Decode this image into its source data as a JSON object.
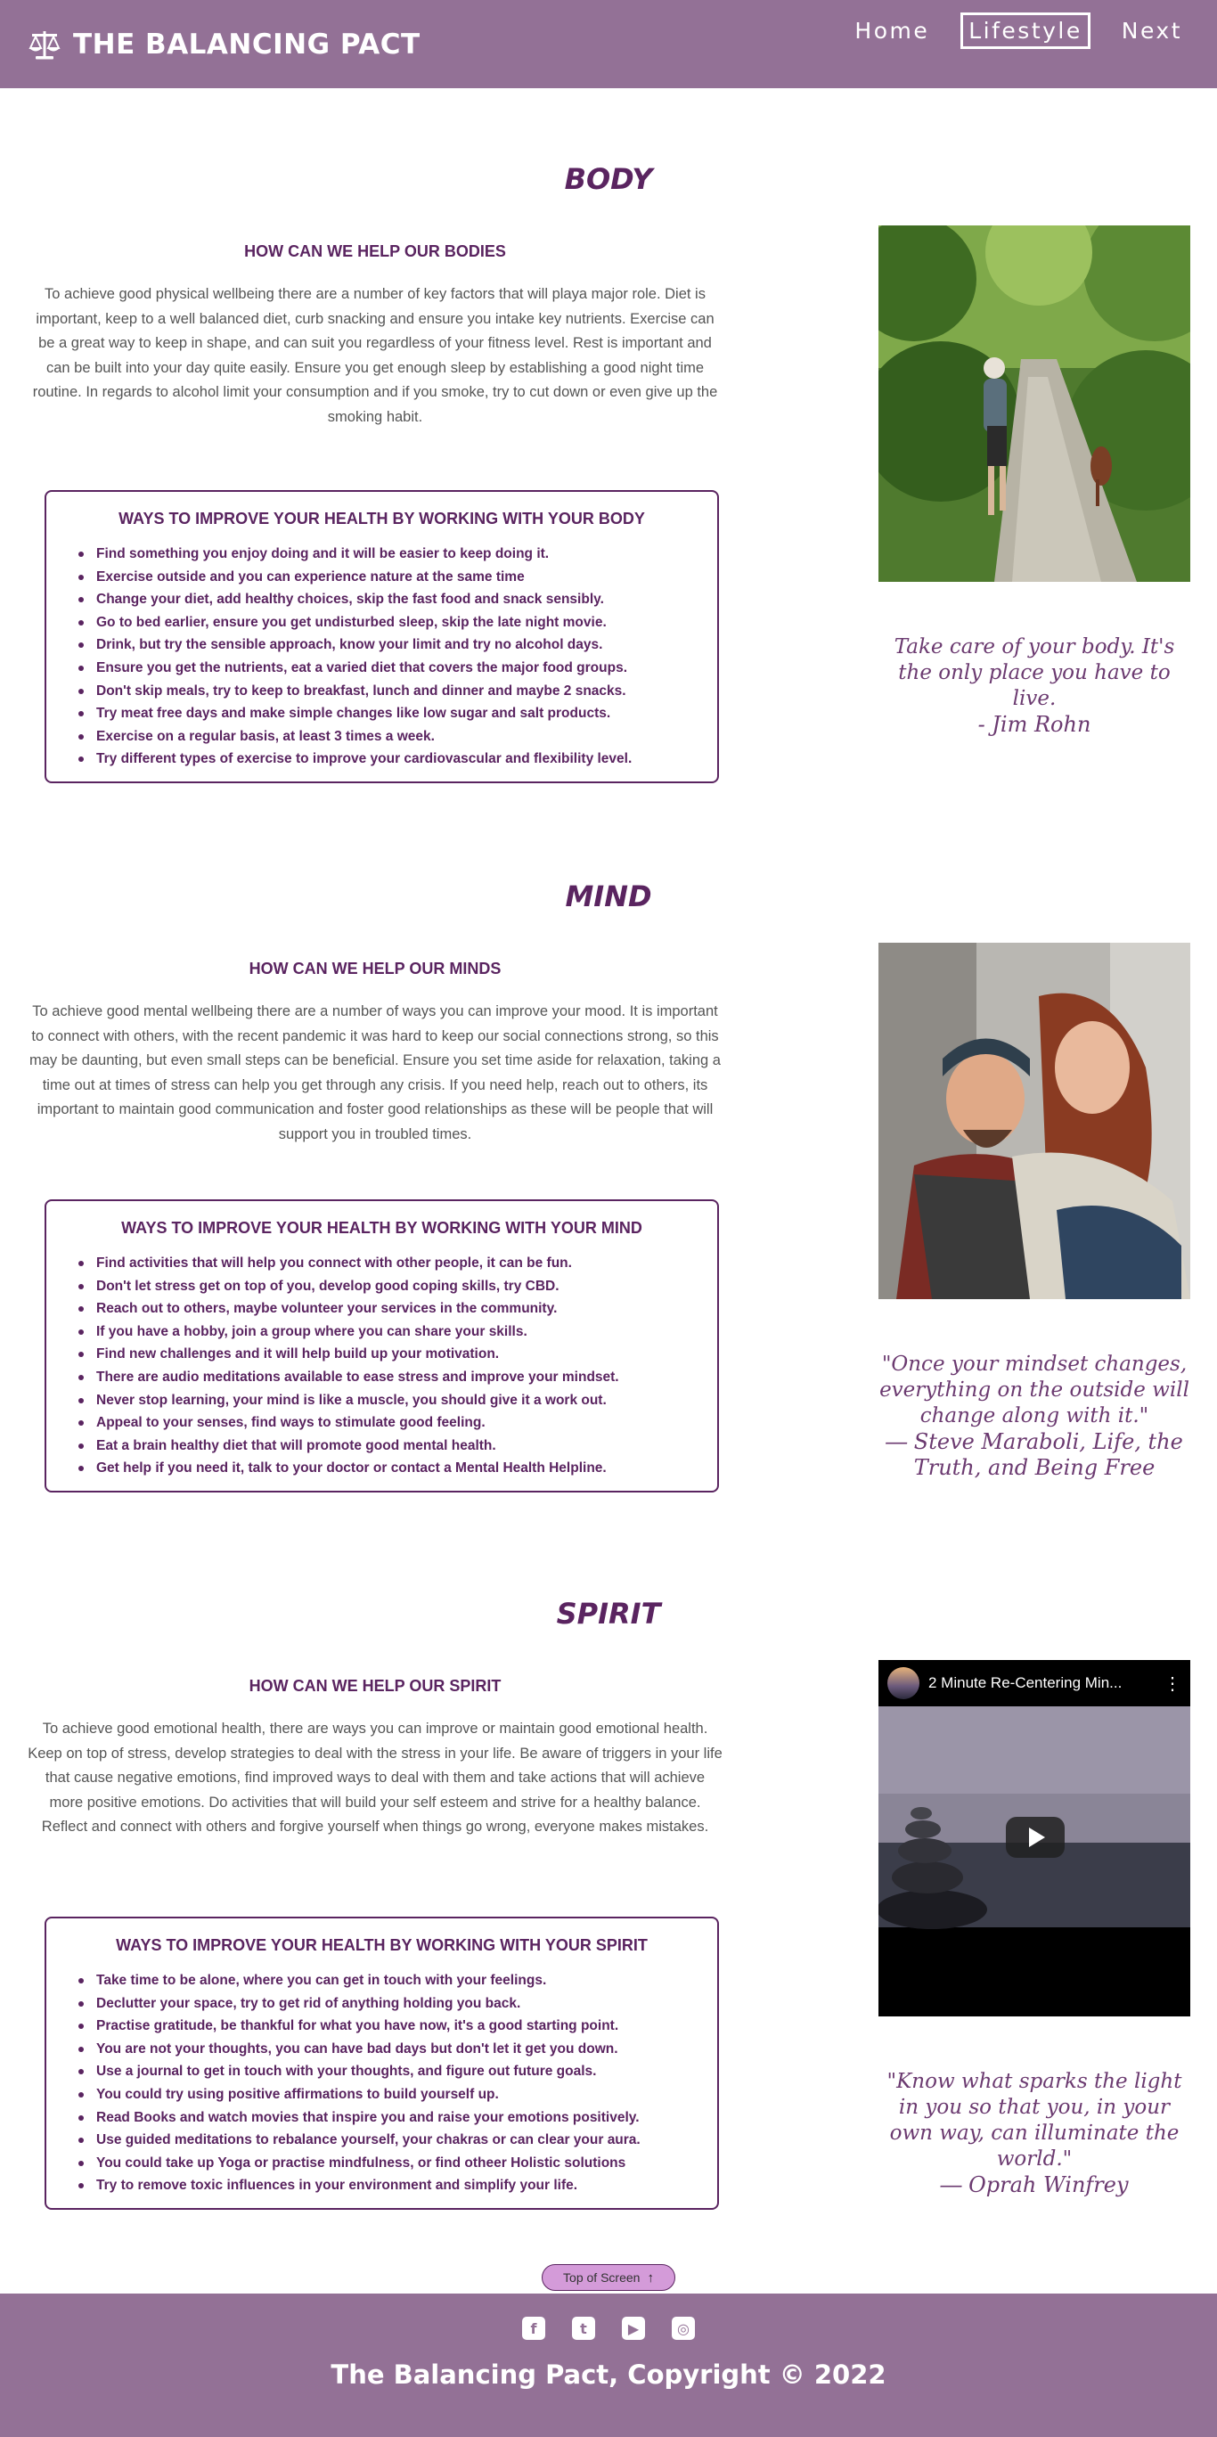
{
  "header": {
    "brand": "THE BALANCING PACT",
    "nav": [
      "Home",
      "Lifestyle",
      "Next"
    ],
    "active_nav": "Lifestyle"
  },
  "body_section": {
    "title": "BODY",
    "help_heading": "HOW CAN WE HELP OUR BODIES",
    "help_text": "To achieve good physical wellbeing there are a number of key factors that will playa major role. Diet is important, keep to a well balanced diet, curb snacking and ensure you intake key nutrients. Exercise can be a great way to keep in shape, and can suit you regardless of your fitness level. Rest is important and can be built into your day quite easily. Ensure you get enough sleep by establishing a good night time routine. In regards to alcohol limit your consumption and if you smoke, try to cut down or even give up the smoking habit.",
    "ways_heading": "WAYS TO IMPROVE YOUR HEALTH BY WORKING WITH YOUR BODY",
    "ways": [
      "Find something you enjoy doing and it will be easier to keep doing it.",
      "Exercise outside and you can experience nature at the same time",
      "Change your diet, add healthy choices, skip the fast food and snack sensibly.",
      "Go to bed earlier, ensure you get undisturbed sleep, skip the late night movie.",
      "Drink, but try the sensible approach, know your limit and try no alcohol days.",
      "Ensure you get the nutrients, eat a varied diet that covers the major food groups.",
      "Don't skip meals, try to keep to breakfast, lunch and dinner and maybe 2 snacks.",
      "Try meat free days and make simple changes like low sugar and salt products.",
      "Exercise on a regular basis, at least 3 times a week.",
      "Try different types of exercise to improve your cardiovascular and flexibility level."
    ],
    "quote": "Take care of your body. It's the only place you have to live.",
    "quote_author": "- Jim Rohn"
  },
  "mind_section": {
    "title": "MIND",
    "help_heading": "HOW CAN WE HELP OUR MINDS",
    "help_text": "To achieve good mental wellbeing there are a number of ways you can improve your mood. It is important to connect with others, with the recent pandemic it was hard to keep our social connections strong, so this may be daunting, but even small steps can be beneficial. Ensure you set time aside for relaxation, taking a time out at times of stress can help you get through any crisis. If you need help, reach out to others, its important to maintain good communication and foster good relationships as these will be people that will support you in troubled times.",
    "ways_heading": "WAYS TO IMPROVE YOUR HEALTH BY WORKING WITH YOUR MIND",
    "ways": [
      "Find activities that will help you connect with other people, it can be fun.",
      "Don't let stress get on top of you, develop good coping skills, try CBD.",
      "Reach out to others, maybe volunteer your services in the community.",
      "If you have a hobby, join a group where you can share your skills.",
      "Find new challenges and it will help build up your motivation.",
      "There are audio meditations available to ease stress and improve your mindset.",
      "Never stop learning, your mind is like a muscle, you should give it a work out.",
      "Appeal to your senses, find ways to stimulate good feeling.",
      "Eat a brain healthy diet that will promote good mental health.",
      "Get help if you need it, talk to your doctor or contact a Mental Health Helpline."
    ],
    "quote": "\"Once your mindset changes, everything on the outside will change along with it.\"",
    "quote_author": "― Steve Maraboli, Life, the Truth, and Being Free"
  },
  "spirit_section": {
    "title": "SPIRIT",
    "help_heading": "HOW CAN WE HELP OUR SPIRIT",
    "help_text": "To achieve good emotional health, there are ways you can improve or maintain good emotional health. Keep on top of stress, develop strategies to deal with the stress in your life. Be aware of triggers in your life that cause negative emotions, find improved ways to deal with them and take actions that will achieve more positive emotions. Do activities that will build your self esteem and strive for a healthy balance. Reflect and connect with others and forgive yourself when things go wrong, everyone makes mistakes.",
    "ways_heading": "WAYS TO IMPROVE YOUR HEALTH BY WORKING WITH YOUR SPIRIT",
    "ways": [
      "Take time to be alone, where you can get in touch with your feelings.",
      "Declutter your space, try to get rid of anything holding you back.",
      "Practise gratitude, be thankful for what you have now, it's a good starting point.",
      "You are not your thoughts, you can have bad days but don't let it get you down.",
      "Use a journal to get in touch with your thoughts, and figure out future goals.",
      "You could try using positive affirmations to build yourself up.",
      "Read Books and watch movies that inspire you and raise your emotions positively.",
      "Use guided meditations to rebalance yourself, your chakras or can clear your aura.",
      "You could take up Yoga or practise mindfulness, or find otheer Holistic solutions",
      "Try to remove toxic influences in your environment and simplify your life."
    ],
    "video_title": "2 Minute Re-Centering Min...",
    "quote": "\"Know what sparks the light in you so that you, in your own way, can illuminate the world.\"",
    "quote_author": "― Oprah Winfrey"
  },
  "top_button": "Top of Screen",
  "footer": {
    "social_icons": [
      "facebook-icon",
      "twitter-icon",
      "youtube-icon",
      "instagram-icon"
    ],
    "copyright": "The Balancing Pact, Copyright © 2022"
  }
}
